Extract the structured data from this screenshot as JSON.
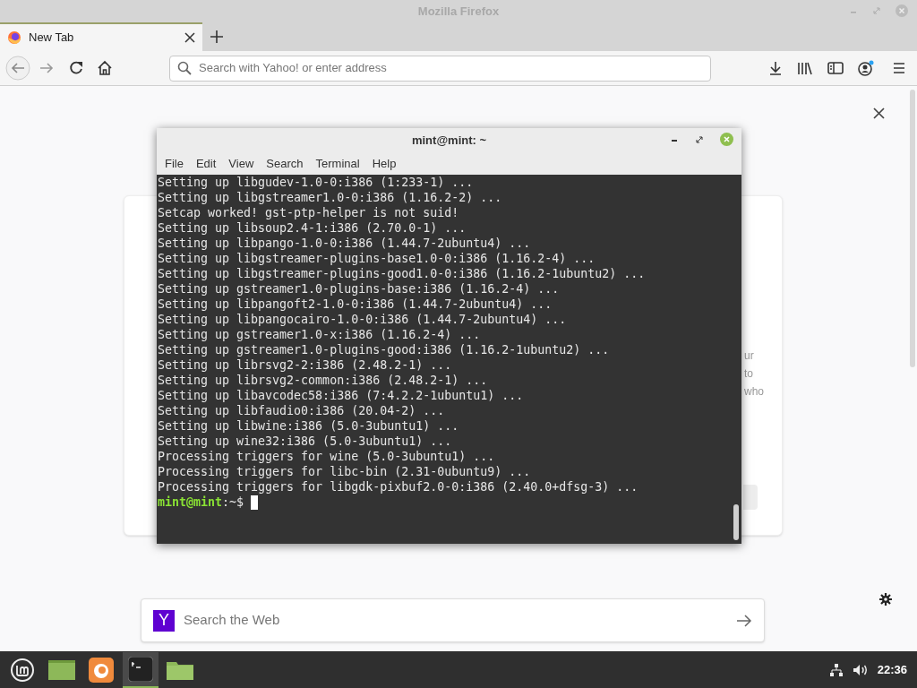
{
  "window": {
    "title": "Mozilla Firefox"
  },
  "tabs": [
    {
      "label": "New Tab",
      "selected": true
    }
  ],
  "address_bar": {
    "placeholder": "Search with Yahoo! or enter address"
  },
  "new_tab_page": {
    "hidden_text_fragments": [
      "ur",
      "to",
      "who"
    ],
    "web_search": {
      "placeholder": "Search the Web",
      "engine_letter": "Y"
    }
  },
  "terminal": {
    "title": "mint@mint: ~",
    "menu": [
      "File",
      "Edit",
      "View",
      "Search",
      "Terminal",
      "Help"
    ],
    "lines": [
      "Setting up libgudev-1.0-0:i386 (1:233-1) ...",
      "Setting up libgstreamer1.0-0:i386 (1.16.2-2) ...",
      "Setcap worked! gst-ptp-helper is not suid!",
      "Setting up libsoup2.4-1:i386 (2.70.0-1) ...",
      "Setting up libpango-1.0-0:i386 (1.44.7-2ubuntu4) ...",
      "Setting up libgstreamer-plugins-base1.0-0:i386 (1.16.2-4) ...",
      "Setting up libgstreamer-plugins-good1.0-0:i386 (1.16.2-1ubuntu2) ...",
      "Setting up gstreamer1.0-plugins-base:i386 (1.16.2-4) ...",
      "Setting up libpangoft2-1.0-0:i386 (1.44.7-2ubuntu4) ...",
      "Setting up libpangocairo-1.0-0:i386 (1.44.7-2ubuntu4) ...",
      "Setting up gstreamer1.0-x:i386 (1.16.2-4) ...",
      "Setting up gstreamer1.0-plugins-good:i386 (1.16.2-1ubuntu2) ...",
      "Setting up librsvg2-2:i386 (2.48.2-1) ...",
      "Setting up librsvg2-common:i386 (2.48.2-1) ...",
      "Setting up libavcodec58:i386 (7:4.2.2-1ubuntu1) ...",
      "Setting up libfaudio0:i386 (20.04-2) ...",
      "Setting up libwine:i386 (5.0-3ubuntu1) ...",
      "Setting up wine32:i386 (5.0-3ubuntu1) ...",
      "Processing triggers for wine (5.0-3ubuntu1) ...",
      "Processing triggers for libc-bin (2.31-0ubuntu9) ...",
      "Processing triggers for libgdk-pixbuf2.0-0:i386 (2.40.0+dfsg-3) ..."
    ],
    "prompt": {
      "user": "mint@mint",
      "rest": ":~$"
    }
  },
  "taskbar": {
    "items": [
      {
        "kind": "menu",
        "selected": false
      },
      {
        "kind": "desktop",
        "selected": false
      },
      {
        "kind": "firefox",
        "selected": false
      },
      {
        "kind": "terminal",
        "selected": true
      },
      {
        "kind": "files",
        "selected": false
      }
    ],
    "clock": "22:36"
  }
}
